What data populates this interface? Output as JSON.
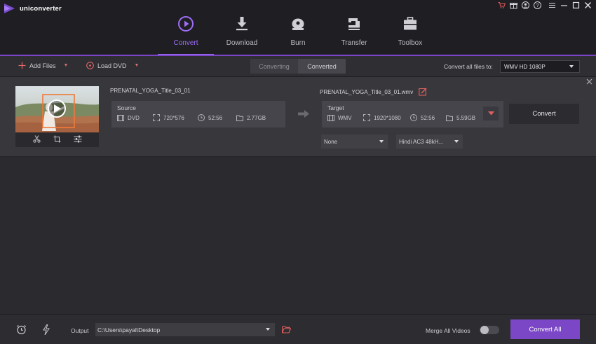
{
  "app": {
    "name": "uniconverter",
    "accent_color": "#9e6ef7",
    "window_controls": [
      "cart-icon",
      "gift-icon",
      "user-icon",
      "help-icon",
      "menu-icon",
      "minimize-icon",
      "maximize-icon",
      "close-icon"
    ]
  },
  "nav": {
    "items": [
      {
        "label": "Convert",
        "icon": "play-circle-icon",
        "active": true
      },
      {
        "label": "Download",
        "icon": "download-icon",
        "active": false
      },
      {
        "label": "Burn",
        "icon": "disc-icon",
        "active": false
      },
      {
        "label": "Transfer",
        "icon": "transfer-icon",
        "active": false
      },
      {
        "label": "Toolbox",
        "icon": "toolbox-icon",
        "active": false
      }
    ]
  },
  "toolbar": {
    "add_files": "Add Files",
    "load_dvd": "Load DVD",
    "tabs": [
      "Converting",
      "Converted"
    ],
    "active_tab": "Converted",
    "convert_all_label": "Convert all files to:",
    "format_value": "WMV HD 1080P"
  },
  "item": {
    "source_name": "PRENATAL_YOGA_Title_03_01",
    "source": {
      "title": "Source",
      "format": "DVD",
      "resolution": "720*576",
      "duration": "52:56",
      "size": "2.77GB"
    },
    "target_name": "PRENATAL_YOGA_Title_03_01.wmv",
    "target": {
      "title": "Target",
      "format": "WMV",
      "resolution": "1920*1080",
      "duration": "52:56",
      "size": "5.59GB"
    },
    "convert_button": "Convert",
    "subtitle_select": "None",
    "audio_select": "Hindi AC3 48kH..."
  },
  "bottom": {
    "output_label": "Output",
    "output_path": "C:\\Users\\payal\\Desktop",
    "merge_label": "Merge All Videos",
    "merge_enabled": false,
    "convert_all_button": "Convert All"
  }
}
